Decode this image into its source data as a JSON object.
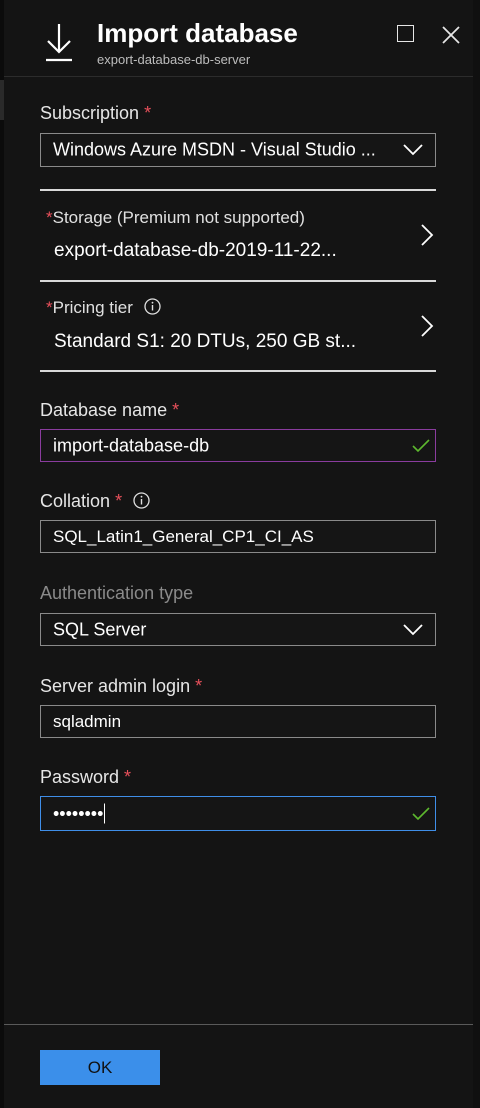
{
  "header": {
    "title": "Import database",
    "subtitle": "export-database-db-server",
    "icon": "download-icon"
  },
  "form": {
    "subscription": {
      "label": "Subscription",
      "required_mark": "*",
      "value": "Windows Azure MSDN - Visual Studio ..."
    },
    "storage": {
      "required_mark": "*",
      "label": "Storage (Premium not supported)",
      "value": "export-database-db-2019-11-22..."
    },
    "pricing_tier": {
      "required_mark": "*",
      "label": "Pricing tier",
      "value": "Standard S1: 20 DTUs, 250 GB st..."
    },
    "database_name": {
      "label": "Database name",
      "required_mark": "*",
      "value": "import-database-db"
    },
    "collation": {
      "label": "Collation",
      "required_mark": "*",
      "value": "SQL_Latin1_General_CP1_CI_AS"
    },
    "authentication_type": {
      "label": "Authentication type",
      "value": "SQL Server"
    },
    "server_admin_login": {
      "label": "Server admin login",
      "required_mark": "*",
      "value": "sqladmin"
    },
    "password": {
      "label": "Password",
      "required_mark": "*",
      "value": "••••••••"
    }
  },
  "footer": {
    "ok_label": "OK"
  },
  "colors": {
    "accent": "#3b8fea",
    "required": "#e8505b",
    "valid_check": "#5db82e",
    "focus_purple": "#8a3c9e"
  }
}
